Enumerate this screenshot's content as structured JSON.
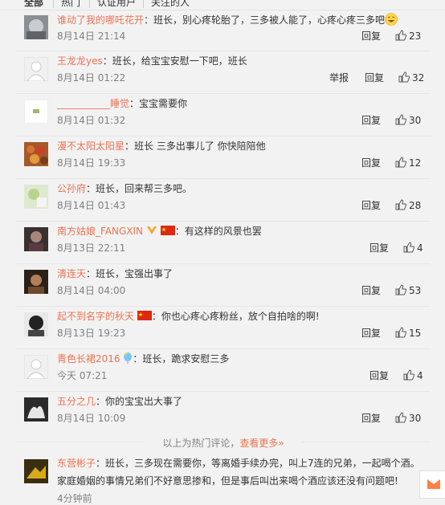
{
  "tabs": [
    "全部",
    "热门",
    "认证用户",
    "关注的人"
  ],
  "comments": [
    {
      "user": "谁动了我的哪吒花开",
      "text": "：班长，别心疼轮胎了，三多被人能了，心疼心疼三多吧",
      "time": "8月14日 21:14",
      "reply": "回复",
      "report": "",
      "likes": "23"
    },
    {
      "user": "王龙龙yes",
      "text": "：班长，给宝宝安慰一下吧，班长",
      "time": "8月14日 01:22",
      "reply": "回复",
      "report": "举报",
      "likes": "32"
    },
    {
      "user": "___________睡觉",
      "text": "：宝宝需要你",
      "time": "8月14日 01:32",
      "reply": "回复",
      "report": "",
      "likes": "30"
    },
    {
      "user": "漫不太阳太阳星",
      "text": "：班长 三多出事儿了 你快陪陪他",
      "time": "8月14日 19:33",
      "reply": "回复",
      "report": "",
      "likes": "12"
    },
    {
      "user": "公孙府",
      "text": "：班长，回来帮三多吧。",
      "time": "8月14日 01:43",
      "reply": "回复",
      "report": "",
      "likes": "28"
    },
    {
      "user": "南方姑娘_FANGXIN",
      "text": "：有这样的风景也罢",
      "time": "8月13日 22:11",
      "reply": "回复",
      "report": "",
      "likes": "4"
    },
    {
      "user": "清连天",
      "text": "：班长，宝强出事了",
      "time": "8月14日 04:00",
      "reply": "回复",
      "report": "",
      "likes": "53"
    },
    {
      "user": "起不到名字的秋天",
      "text": "：你也心疼心疼粉丝，放个自拍啥的啊!",
      "time": "8月13日 19:23",
      "reply": "回复",
      "report": "",
      "likes": "15"
    },
    {
      "user": "青色长裙2016",
      "text": "：班长，跪求安慰三多",
      "time": "今天 07:21",
      "reply": "回复",
      "report": "",
      "likes": "4"
    },
    {
      "user": "五分之几",
      "text": "：你的宝宝出大事了",
      "time": "8月14日 10:09",
      "reply": "回复",
      "report": "",
      "likes": "30"
    }
  ],
  "more": {
    "prefix": "以上为热门评论，",
    "link": "查看更多»"
  },
  "last_comment": {
    "user": "东营彬子",
    "text": "：班长，三多现在需要你，等离婚手续办完，叫上7连的兄弟，一起喝个酒。",
    "text2": "家庭婚姻的事情兄弟们不好意思掺和，但是事后叫出来喝个酒应该还没有问题吧!",
    "time": "4分钟前"
  },
  "colors": {
    "username": "#eb7350",
    "meta": "#808080",
    "background": "#f2f2f2",
    "accent": "#ff8140"
  },
  "icons": {
    "like": "thumbs-up-icon",
    "mail": "mail-icon"
  }
}
